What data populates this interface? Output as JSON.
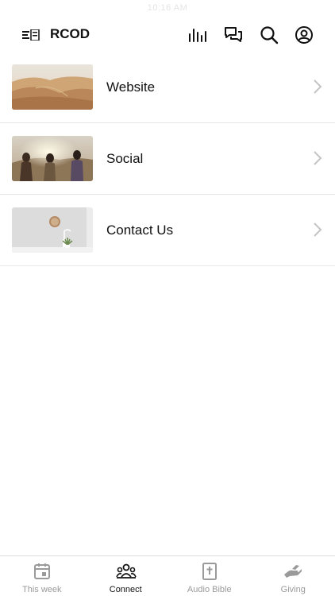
{
  "status_bar": {
    "time": "10:16 AM"
  },
  "header": {
    "logo_icon": "church-logo-icon",
    "title": "RCOD",
    "actions": [
      "audio-bars-icon",
      "chat-icon",
      "search-icon",
      "profile-icon"
    ]
  },
  "rows": [
    {
      "label": "Website",
      "thumbnail": "desert-dunes-photo"
    },
    {
      "label": "Social",
      "thumbnail": "friends-sunset-photo"
    },
    {
      "label": "Contact Us",
      "thumbnail": "wall-clock-plant-photo"
    }
  ],
  "tabs": [
    {
      "label": "This week",
      "icon": "calendar-icon",
      "active": false
    },
    {
      "label": "Connect",
      "icon": "people-icon",
      "active": true
    },
    {
      "label": "Audio Bible",
      "icon": "bible-icon",
      "active": false
    },
    {
      "label": "Giving",
      "icon": "giving-hand-icon",
      "active": false
    }
  ],
  "colors": {
    "active": "#111111",
    "inactive": "#9a9a9a",
    "divider": "#e6e6e6"
  }
}
